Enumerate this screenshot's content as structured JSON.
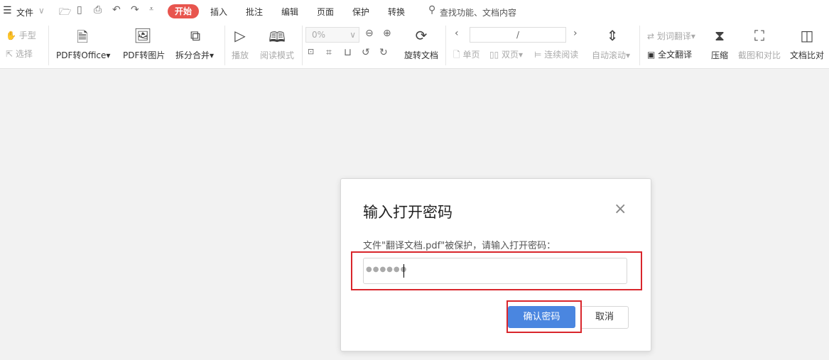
{
  "menu": {
    "file_label": "文件",
    "tabs": [
      "开始",
      "插入",
      "批注",
      "编辑",
      "页面",
      "保护",
      "转换"
    ],
    "active_tab": "开始",
    "search_placeholder": "查找功能、文档内容"
  },
  "toolbar": {
    "hand": "手型",
    "select": "选择",
    "pdf_to_office": "PDF转Office",
    "pdf_to_image": "PDF转图片",
    "split_merge": "拆分合并",
    "play": "播放",
    "read_mode": "阅读模式",
    "zoom_value": "0%",
    "rotate": "旋转文档",
    "page_value": "/",
    "single": "单页",
    "double": "双页",
    "continuous": "连续阅读",
    "auto_scroll": "自动滚动",
    "word_translate": "划词翻译",
    "full_translate": "全文翻译",
    "compress": "压缩",
    "screenshot_compare": "截图和对比",
    "doc_compare": "文档比对"
  },
  "dialog": {
    "title": "输入打开密码",
    "message": "文件\"翻译文档.pdf\"被保护，请输入打开密码：",
    "password_mask": "●●●●●●",
    "confirm": "确认密码",
    "cancel": "取消"
  },
  "colors": {
    "accent": "#e8554e",
    "primary": "#4a86e0",
    "highlight": "#d9262c"
  }
}
